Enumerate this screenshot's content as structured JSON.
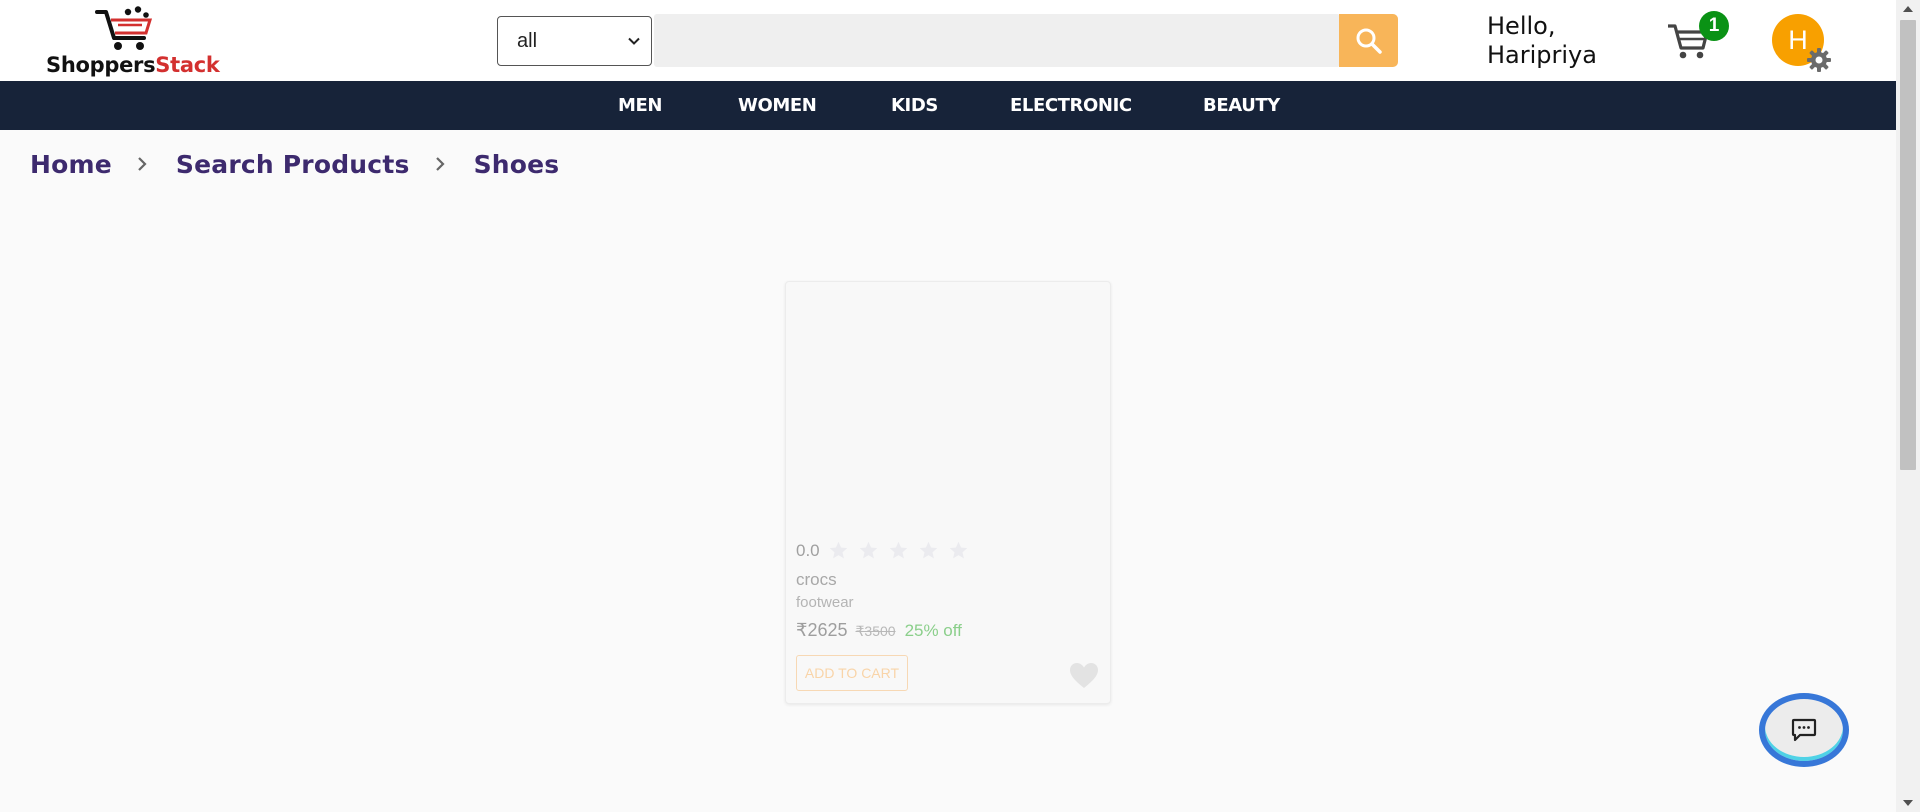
{
  "brand": {
    "part1": "Shoppers",
    "part2": "Stack"
  },
  "search": {
    "category": "all",
    "placeholder": ""
  },
  "user": {
    "greeting_line1": "Hello,",
    "greeting_line2": "Haripriya",
    "avatar_initial": "H"
  },
  "cart": {
    "count": "1"
  },
  "nav": {
    "items": [
      "MEN",
      "WOMEN",
      "KIDS",
      "ELECTRONIC",
      "BEAUTY"
    ]
  },
  "breadcrumb": [
    "Home",
    "Search Products",
    "Shoes"
  ],
  "product": {
    "rating": "0.0",
    "stars_filled": 0,
    "stars_total": 5,
    "name": "crocs",
    "category": "footwear",
    "price": "₹2625",
    "mrp": "₹3500",
    "discount": "25% off",
    "add_to_cart_label": "ADD TO CART"
  },
  "colors": {
    "accent": "#f8b559",
    "nav_background": "#172339",
    "brand_red": "#d3302f",
    "badge_green": "#0a9215",
    "avatar": "#f8a000"
  },
  "icons": [
    "search-icon",
    "chevron-down-icon",
    "cart-icon",
    "settings-gear-icon",
    "chevron-right-icon",
    "star-icon",
    "heart-icon",
    "chat-icon"
  ]
}
